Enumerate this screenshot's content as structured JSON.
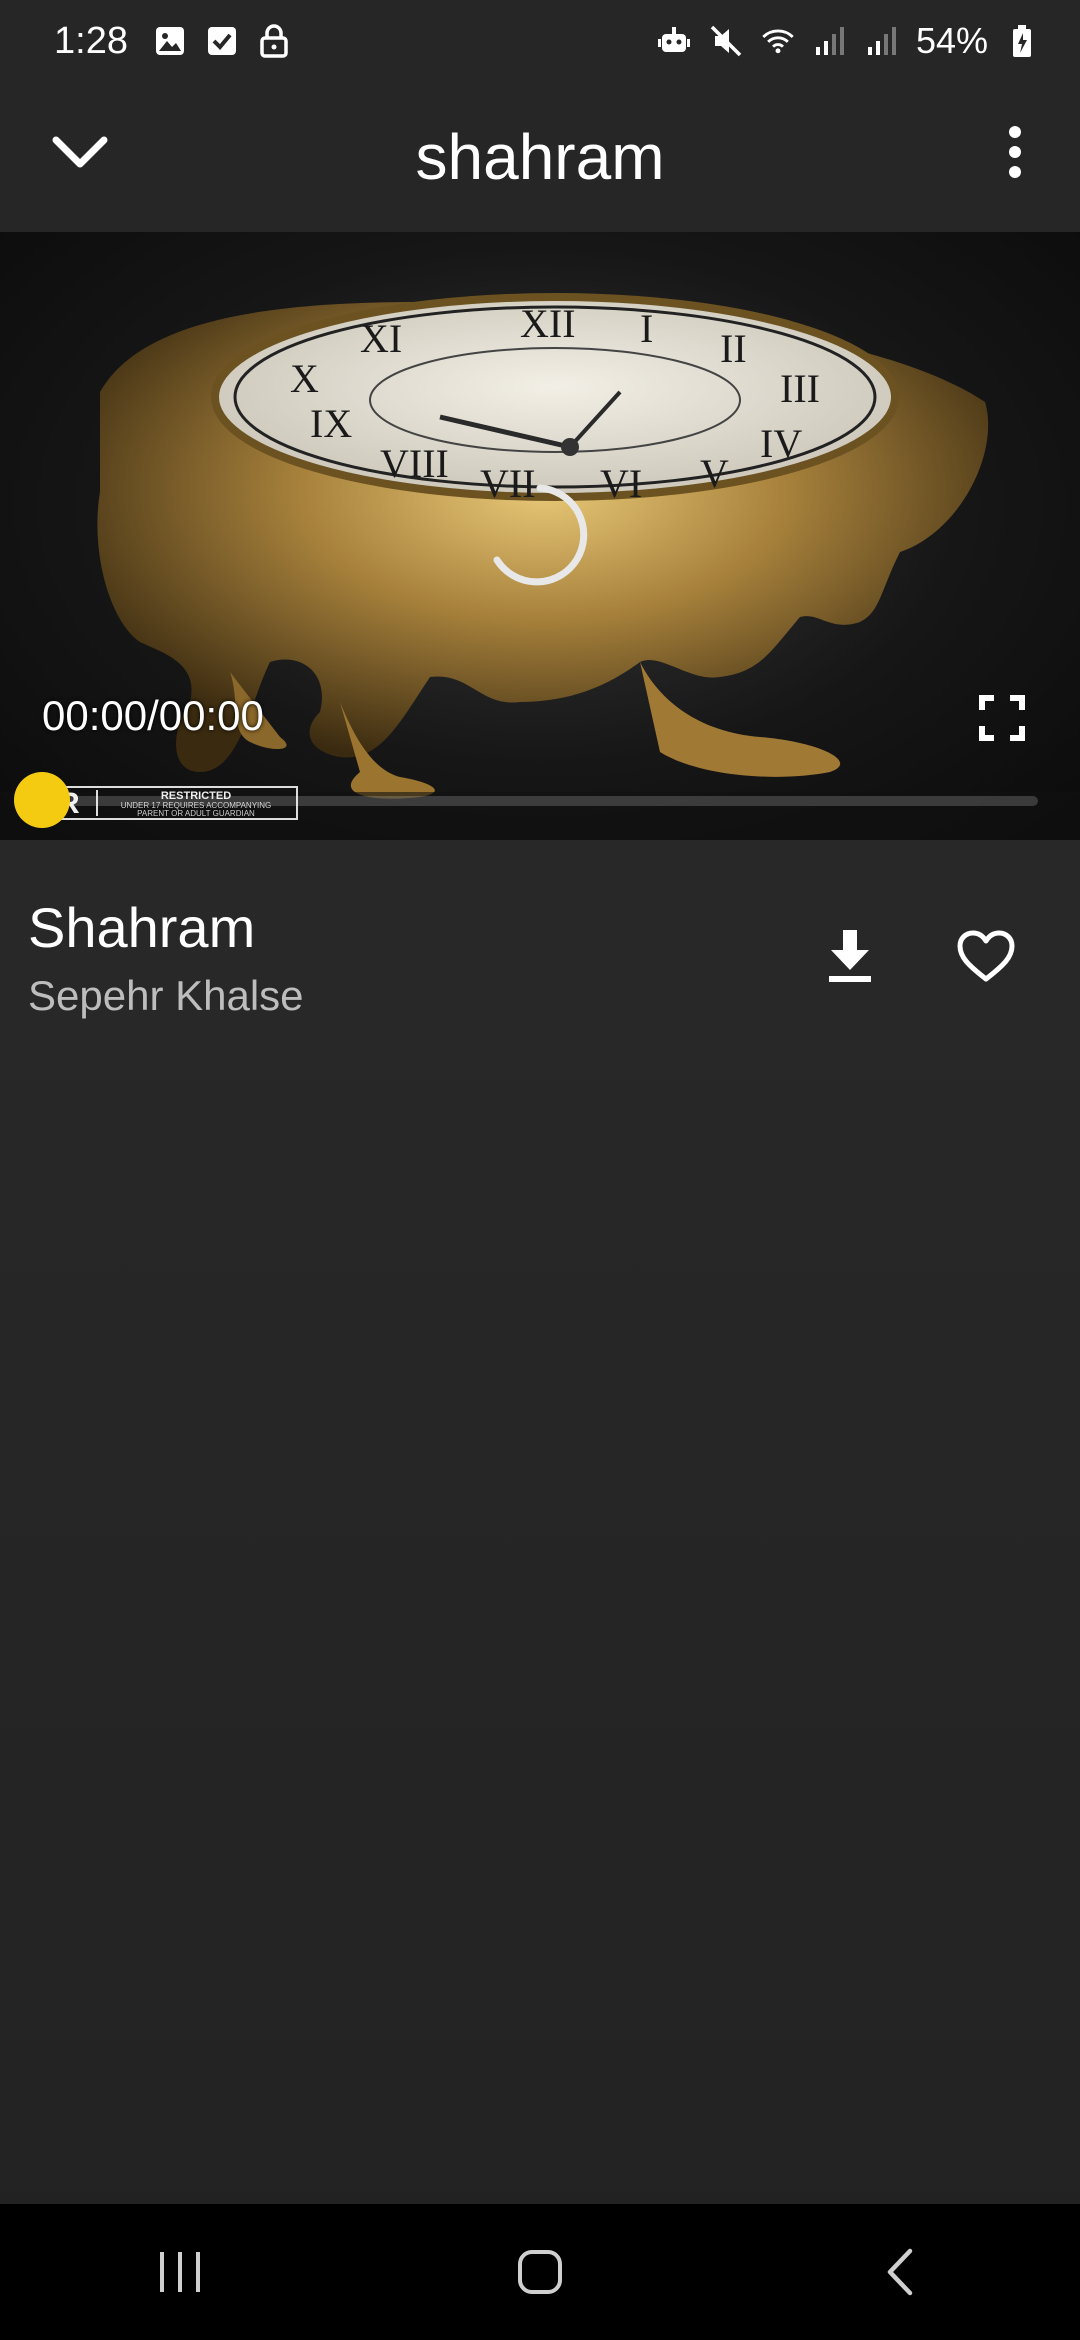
{
  "status_bar": {
    "time": "1:28",
    "battery": "54%",
    "left_icons": [
      "image-icon",
      "checkbox-icon",
      "lock-icon"
    ],
    "right_icons": [
      "robot-icon",
      "mute-icon",
      "wifi-icon",
      "signal-icon",
      "signal-icon",
      "battery-icon"
    ]
  },
  "app_bar": {
    "title": "shahram",
    "back_icon": "chevron-down-icon",
    "menu_icon": "more-vertical-icon"
  },
  "player": {
    "time_display": "00:00/00:00",
    "progress": 0,
    "accent_color": "#f5cb12",
    "rating_badge": {
      "letter": "R",
      "title": "RESTRICTED",
      "line1": "UNDER 17 REQUIRES ACCOMPANYING",
      "line2": "PARENT OR ADULT GUARDIAN"
    }
  },
  "song": {
    "title": "Shahram",
    "artist": "Sepehr Khalse",
    "download_icon": "download-icon",
    "favorite_icon": "heart-outline-icon"
  },
  "nav_bar": {
    "buttons": [
      "recents-icon",
      "home-icon",
      "back-icon"
    ]
  }
}
